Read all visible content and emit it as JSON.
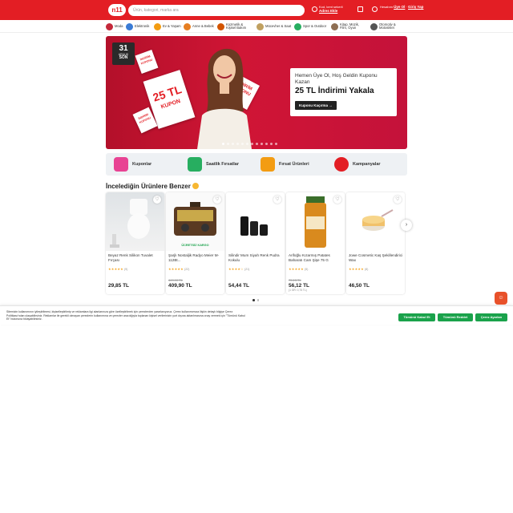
{
  "header": {
    "logo": "n11",
    "search_placeholder": "Ürün, kategori, marka ara",
    "address_line1": "Kod, kent sekerli",
    "address_line2": "Adres Ekle",
    "account_line1": "Hesabım",
    "account_login": "Üye Ol",
    "account_sep": "·",
    "account_signin": "Giriş Yap"
  },
  "categories": [
    {
      "label": "Moda",
      "color": "#c4283a"
    },
    {
      "label": "Elektronik",
      "color": "#3a7bd5"
    },
    {
      "label": "Ev & Yaşam",
      "color": "#f39c12"
    },
    {
      "label": "Anne & Bebek",
      "color": "#e67e22"
    },
    {
      "label": "Kozmetik & Kişisel Bakım",
      "color": "#d35400"
    },
    {
      "label": "Mücevher & Saat",
      "color": "#c0a060"
    },
    {
      "label": "Spor & Outdoor",
      "color": "#27ae60"
    },
    {
      "label": "Kitap, Müzik, Film, Oyun",
      "color": "#8e6e53"
    },
    {
      "label": "Otomotiv & Motosiklet",
      "color": "#555555"
    }
  ],
  "banner": {
    "date_day": "31",
    "date_month": "ARALIK",
    "date_tag": "SON",
    "card_big": "25 TL",
    "card_big_sub": "KUPON",
    "card_small": "İNDİRİM KUPONU",
    "promo_line1": "Hemen Üye Ol, Hoş Geldin Kuponu Kazan",
    "promo_line2": "25 TL İndirimi Yakala",
    "promo_button": "Kuponu Kaçırma →"
  },
  "quick_links": [
    {
      "label": "Kuponlar",
      "color": "#e84393"
    },
    {
      "label": "Saatlik Fırsatlar",
      "color": "#27ae60"
    },
    {
      "label": "Fırsat Ürünleri",
      "color": "#f39c12"
    },
    {
      "label": "Kampanyalar",
      "color": "#e31e24"
    }
  ],
  "section_title": "İncelediğin Ürünlere Benzer",
  "products": [
    {
      "name": "Beyaz Renk Silikon Tuvalet Fırçası",
      "stars": "★★★★★",
      "count": "(9)",
      "old": "",
      "price": "29,85 TL",
      "unit": "",
      "ship": ""
    },
    {
      "name": "Şarjlı Nostaljik Radyo Meier M-112Bt...",
      "stars": "★★★★★",
      "count": "(22)",
      "old": "449,90 TL",
      "price": "409,90 TL",
      "unit": "",
      "ship": "ÜCRETSİZ KARGO"
    },
    {
      "name": "Silindir Mum Siyah Renk Pudra Kokulu",
      "stars": "★★★★☆",
      "count": "(21)",
      "old": "",
      "price": "54,44 TL",
      "unit": "",
      "ship": ""
    },
    {
      "name": "Arifoğlu Kızarmış Patates Baharatı Cam Şişe 75 G",
      "stars": "★★★★★",
      "count": "(5)",
      "old": "75,13 TL",
      "price": "56,12 TL",
      "unit": "(1 GR: 0,75 TL)",
      "ship": ""
    },
    {
      "name": "Jowe Cosmetic Kaş Şekillendirici Wax",
      "stars": "★★★★★",
      "count": "(8)",
      "old": "",
      "price": "46,50 TL",
      "unit": "",
      "ship": ""
    }
  ],
  "cookie": {
    "text": "Sitemizin kullanımının iyileştirilmesi, kişiselleştirilmiş ve reklamlara ilgi alanlarınıza göre özelleştirilmek için çerezlerden yararlanıyoruz. Çerez kullanımımıza ilişkin detaylı bilgiye Çerez Politikası'ndan ulaşabilirsiniz. Reklamlar ile gerekli olmayan çerezlerin kullanımına ve çerezler aracılığıyla toplanan kişisel verilerinizin yurt dışına aktarılmasına onay vermek için \"Tümünü Kabul Et\" butonuna tıklayabilirsiniz.",
    "accept_all": "Tümünü Kabul Et",
    "reject_all": "Tümünü Reddet",
    "settings": "Çerez Ayarları"
  }
}
